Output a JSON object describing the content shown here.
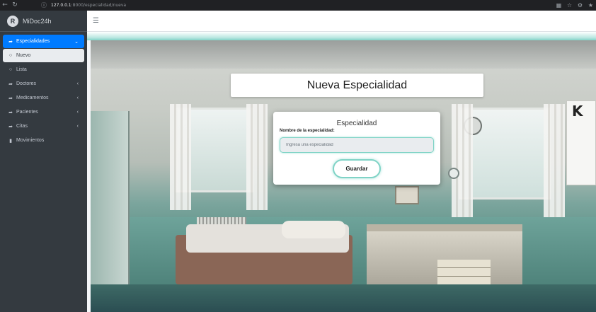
{
  "browser": {
    "back_icon": "arrow-left-icon",
    "reload_icon": "reload-icon",
    "url_host": "127.0.0.1",
    "url_path": ":8000/especialidad/nueva"
  },
  "sidebar": {
    "brand_letter": "R",
    "brand_name": "MiDoc24h",
    "items": [
      {
        "label": "Especialidades",
        "icon": "share-arrow-icon",
        "state": "active"
      },
      {
        "label": "Nuevo",
        "icon": "circle-icon",
        "state": "sub-active"
      },
      {
        "label": "Lista",
        "icon": "circle-icon",
        "state": "normal"
      },
      {
        "label": "Doctores",
        "icon": "share-arrow-icon",
        "state": "normal"
      },
      {
        "label": "Medicamentos",
        "icon": "share-arrow-icon",
        "state": "normal"
      },
      {
        "label": "Pacientes",
        "icon": "share-arrow-icon",
        "state": "normal"
      },
      {
        "label": "Citas",
        "icon": "share-arrow-icon",
        "state": "normal"
      },
      {
        "label": "Movimientos",
        "icon": "file-icon",
        "state": "normal"
      }
    ]
  },
  "main": {
    "page_title": "Nueva Especialidad",
    "form": {
      "heading": "Especialidad",
      "field_label": "Nombre de la especialidad:",
      "field_placeholder": "Ingresa una especialidad",
      "field_value": "",
      "submit_label": "Guardar"
    }
  },
  "colors": {
    "sidebar_bg": "#343a40",
    "active_item": "#007bff",
    "accent_teal": "#7fd3c6"
  }
}
